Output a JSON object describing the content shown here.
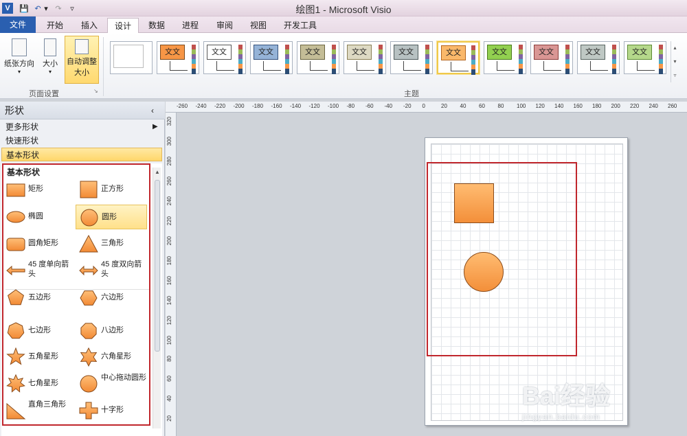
{
  "titlebar": {
    "app_title": "绘图1 - Microsoft Visio",
    "quick_access": [
      "V",
      "💾",
      "↶",
      "▾",
      "↷",
      "▿"
    ]
  },
  "tabs": [
    "文件",
    "开始",
    "插入",
    "设计",
    "数据",
    "进程",
    "审阅",
    "视图",
    "开发工具"
  ],
  "active_tab": "设计",
  "ribbon": {
    "page_setup": {
      "orientation_label": "纸张方向",
      "size_label": "大小",
      "auto_size_label_1": "自动调整",
      "auto_size_label_2": "大小",
      "group_label": "页面设置"
    },
    "themes": {
      "group_label": "主题",
      "tile_text": "文文",
      "tiles": [
        {
          "fill": "#ffffff",
          "border": "#bfbfbf"
        },
        {
          "fill": "#f79646",
          "border": "#7a4a1e"
        },
        {
          "fill": "#ffffff",
          "border": "#555555"
        },
        {
          "fill": "#95b3d7",
          "border": "#34507a"
        },
        {
          "fill": "#c4bd97",
          "border": "#6b6540"
        },
        {
          "fill": "#ddd9c3",
          "border": "#8a7f55"
        },
        {
          "fill": "#b7c1c2",
          "border": "#4e5a5c"
        },
        {
          "fill": "#fab86a",
          "border": "#b5651d"
        },
        {
          "fill": "#92d050",
          "border": "#4a7a1a"
        },
        {
          "fill": "#d99694",
          "border": "#8a3c3a"
        },
        {
          "fill": "#bfc8c4",
          "border": "#586460"
        },
        {
          "fill": "#b5d88b",
          "border": "#5e8a33"
        }
      ]
    }
  },
  "shapes_panel": {
    "title": "形状",
    "more_shapes": "更多形状",
    "quick_shapes": "快速形状",
    "basic_shapes_row": "基本形状",
    "stencil_title": "基本形状",
    "items": [
      {
        "label": "矩形",
        "shape": "rect"
      },
      {
        "label": "正方形",
        "shape": "square"
      },
      {
        "label": "椭圆",
        "shape": "ellipse"
      },
      {
        "label": "圆形",
        "shape": "circle"
      },
      {
        "label": "圆角矩形",
        "shape": "rounded-rect"
      },
      {
        "label": "三角形",
        "shape": "triangle"
      },
      {
        "label": "45 度单向箭头",
        "shape": "single-arrow"
      },
      {
        "label": "45 度双向箭头",
        "shape": "double-arrow"
      },
      {
        "label": "五边形",
        "shape": "pentagon"
      },
      {
        "label": "六边形",
        "shape": "hexagon"
      },
      {
        "label": "七边形",
        "shape": "heptagon"
      },
      {
        "label": "八边形",
        "shape": "octagon"
      },
      {
        "label": "五角星形",
        "shape": "star5"
      },
      {
        "label": "六角星形",
        "shape": "star6"
      },
      {
        "label": "七角星形",
        "shape": "star7"
      },
      {
        "label": "中心拖动圆形",
        "shape": "center-circle"
      },
      {
        "label": "直角三角形",
        "shape": "right-triangle"
      },
      {
        "label": "十字形",
        "shape": "cross"
      }
    ],
    "selected_item": "圆形"
  },
  "rulers": {
    "top_ticks": [
      "-260",
      "-240",
      "-220",
      "-200",
      "-180",
      "-160",
      "-140",
      "-120",
      "-100",
      "-80",
      "-60",
      "-40",
      "-20",
      "0",
      "20",
      "40",
      "60",
      "80",
      "100",
      "120",
      "140",
      "160",
      "180",
      "200",
      "220",
      "240",
      "260"
    ],
    "left_ticks": [
      "320",
      "300",
      "280",
      "260",
      "240",
      "220",
      "200",
      "180",
      "160",
      "140",
      "120",
      "100",
      "80",
      "60",
      "40",
      "20"
    ]
  },
  "watermark": {
    "text": "Bai经验",
    "sub": "jingyan.baidu.com"
  },
  "colors": {
    "accent": "#2a5fb0",
    "selection_red": "#c0262c",
    "shape_orange": "#f79646"
  }
}
